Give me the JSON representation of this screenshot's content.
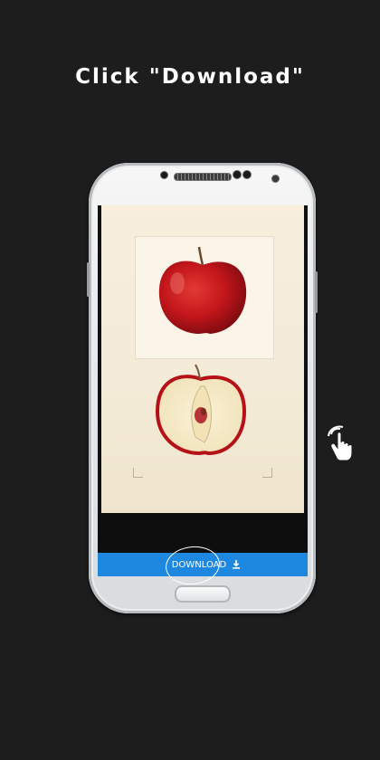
{
  "instruction": {
    "text": "Click \"Download\""
  },
  "app": {
    "download_button": {
      "label": "DOWNLOAD",
      "icon": "download-icon"
    },
    "accent_color": "#1e88e0"
  },
  "artwork": {
    "subject": "apple-illustration"
  },
  "gesture_hint": {
    "icon": "tap-hand-icon"
  }
}
